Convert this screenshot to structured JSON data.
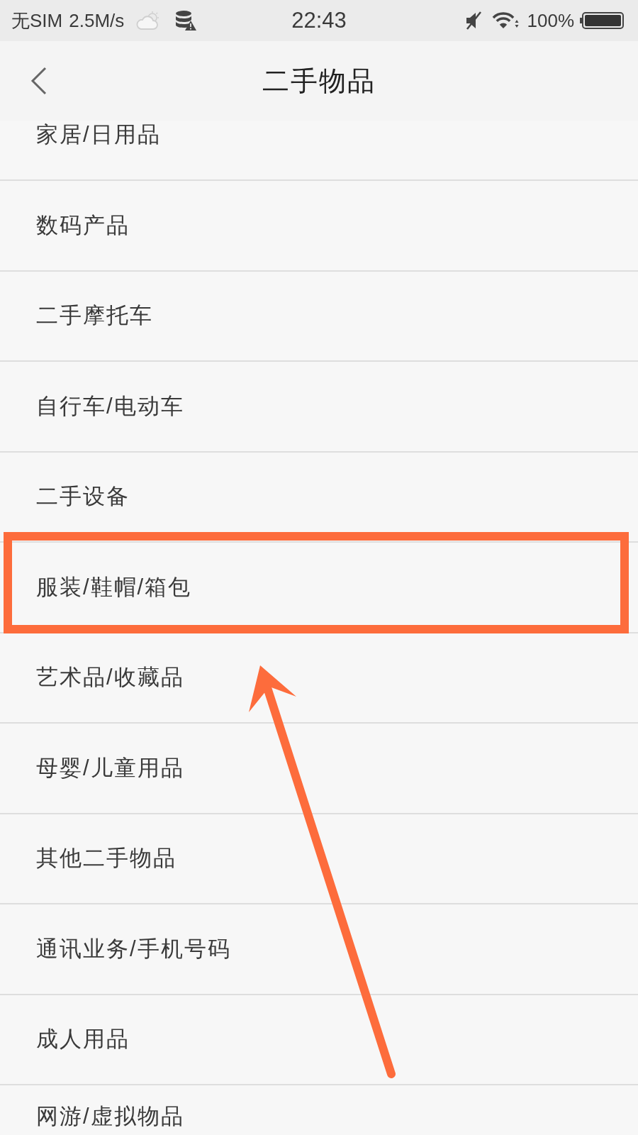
{
  "status_bar": {
    "carrier": "无SIM",
    "speed": "2.5M/s",
    "time": "22:43",
    "battery": "100%"
  },
  "nav_bar": {
    "title": "二手物品"
  },
  "items": [
    {
      "label": "家居/日用品",
      "highlighted": false
    },
    {
      "label": "数码产品",
      "highlighted": false
    },
    {
      "label": "二手摩托车",
      "highlighted": false
    },
    {
      "label": "自行车/电动车",
      "highlighted": false
    },
    {
      "label": "二手设备",
      "highlighted": false
    },
    {
      "label": "服装/鞋帽/箱包",
      "highlighted": true
    },
    {
      "label": "艺术品/收藏品",
      "highlighted": false
    },
    {
      "label": "母婴/儿童用品",
      "highlighted": false
    },
    {
      "label": "其他二手物品",
      "highlighted": false
    },
    {
      "label": "通讯业务/手机号码",
      "highlighted": false
    },
    {
      "label": "成人用品",
      "highlighted": false
    },
    {
      "label": "网游/虚拟物品",
      "highlighted": false
    }
  ]
}
